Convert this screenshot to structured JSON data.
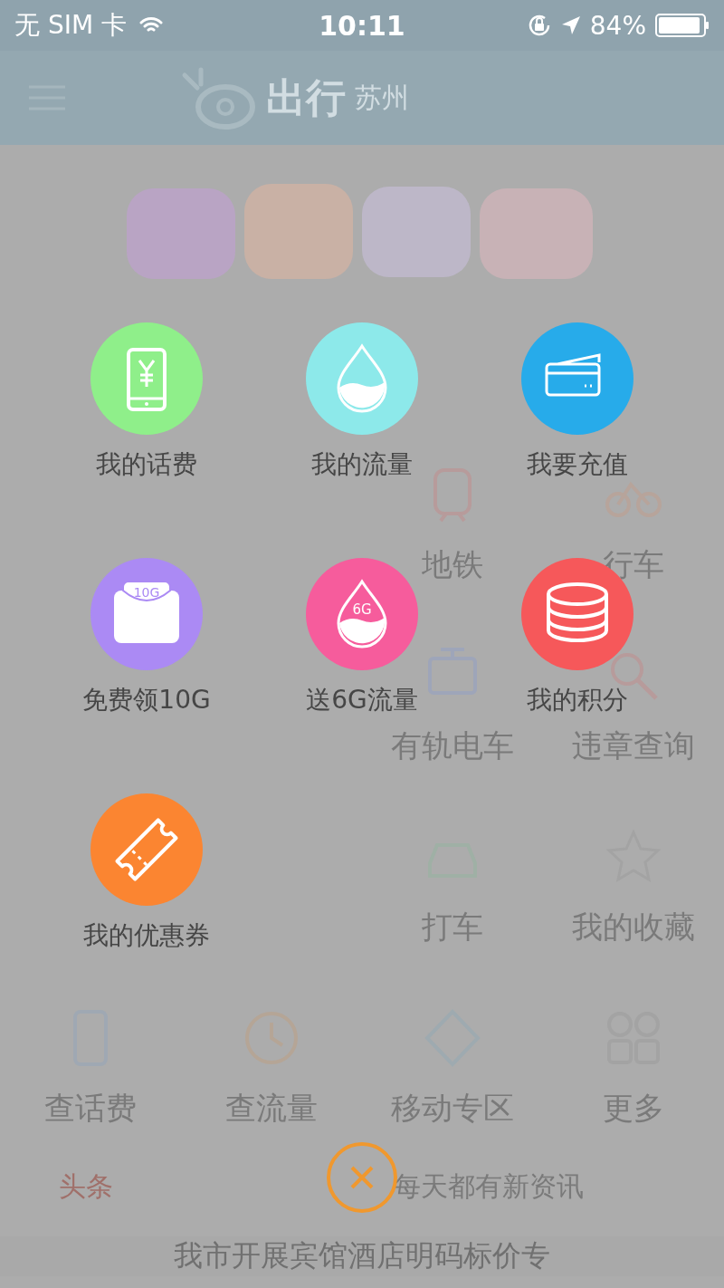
{
  "status_bar": {
    "carrier": "无 SIM 卡",
    "time": "10:11",
    "battery": "84%"
  },
  "header": {
    "logo_text": "出行",
    "city": "苏州"
  },
  "background_rows": [
    {
      "items": [
        {
          "label": "地铁",
          "kind": "metro"
        },
        {
          "label": "行车",
          "kind": "bike"
        }
      ]
    },
    {
      "items": [
        {
          "label": "有轨电车",
          "kind": "tram"
        },
        {
          "label": "违章查询",
          "kind": "search"
        }
      ]
    },
    {
      "items": [
        {
          "label": "打车",
          "kind": "taxi"
        },
        {
          "label": "我的收藏",
          "kind": "star"
        }
      ]
    },
    {
      "items": [
        {
          "label": "查话费",
          "kind": "phone"
        },
        {
          "label": "查流量",
          "kind": "clock"
        },
        {
          "label": "移动专区",
          "kind": "mobile"
        },
        {
          "label": "更多",
          "kind": "grid"
        }
      ]
    }
  ],
  "news": {
    "tag": "头条",
    "tagline": "每天都有新资讯",
    "headline": "我市开展宾馆酒店明码标价专"
  },
  "menu": [
    {
      "label": "我的话费",
      "kind": "phone",
      "color": "#8fef8a"
    },
    {
      "label": "我的流量",
      "kind": "drop",
      "color": "#8de9ea"
    },
    {
      "label": "我要充值",
      "kind": "card",
      "color": "#27abea"
    },
    {
      "label": "免费领10G",
      "kind": "envelope",
      "color": "#ab8af4",
      "badge": "10G"
    },
    {
      "label": "送6G流量",
      "kind": "drop",
      "color": "#f65c9c",
      "badge": "6G"
    },
    {
      "label": "我的积分",
      "kind": "coins",
      "color": "#f6585a"
    },
    {
      "label": "我的优惠券",
      "kind": "ticket",
      "color": "#fb8531"
    }
  ]
}
